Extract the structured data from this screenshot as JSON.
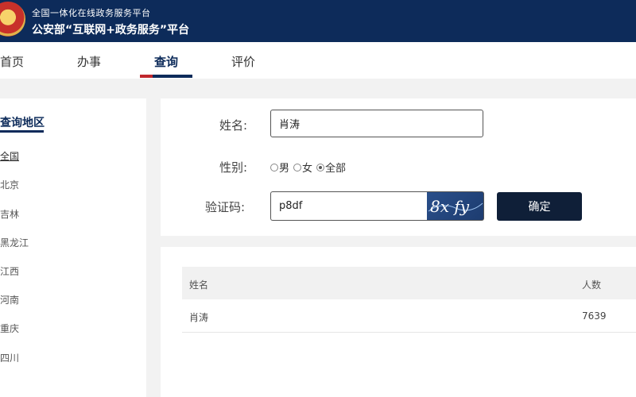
{
  "header": {
    "subtitle": "全国一体化在线政务服务平台",
    "title": "公安部“互联网+政务服务”平台"
  },
  "nav": {
    "items": [
      {
        "label": "首页"
      },
      {
        "label": "办事"
      },
      {
        "label": "查询"
      },
      {
        "label": "评价"
      }
    ],
    "active": "查询"
  },
  "sidebar": {
    "title": "查询地区",
    "items": [
      {
        "label": "全国"
      },
      {
        "label": "北京"
      },
      {
        "label": "吉林"
      },
      {
        "label": "黑龙江"
      },
      {
        "label": "江西"
      },
      {
        "label": "河南"
      },
      {
        "label": "重庆"
      },
      {
        "label": "四川"
      }
    ],
    "selected": "全国"
  },
  "form": {
    "name_label": "姓名:",
    "name_value": "肖涛",
    "gender_label": "性别:",
    "gender_options": [
      "男",
      "女",
      "全部"
    ],
    "gender_selected": "全部",
    "captcha_label": "验证码:",
    "captcha_value": "p8df",
    "captcha_image_text": "8x fy",
    "confirm_label": "确定"
  },
  "results": {
    "columns": [
      "姓名",
      "人数"
    ],
    "rows": [
      {
        "name": "肖涛",
        "count": "7639"
      }
    ]
  },
  "colors": {
    "header_bg": "#0d2b5a",
    "accent_red": "#c0272d",
    "button_bg": "#0f1f38"
  }
}
